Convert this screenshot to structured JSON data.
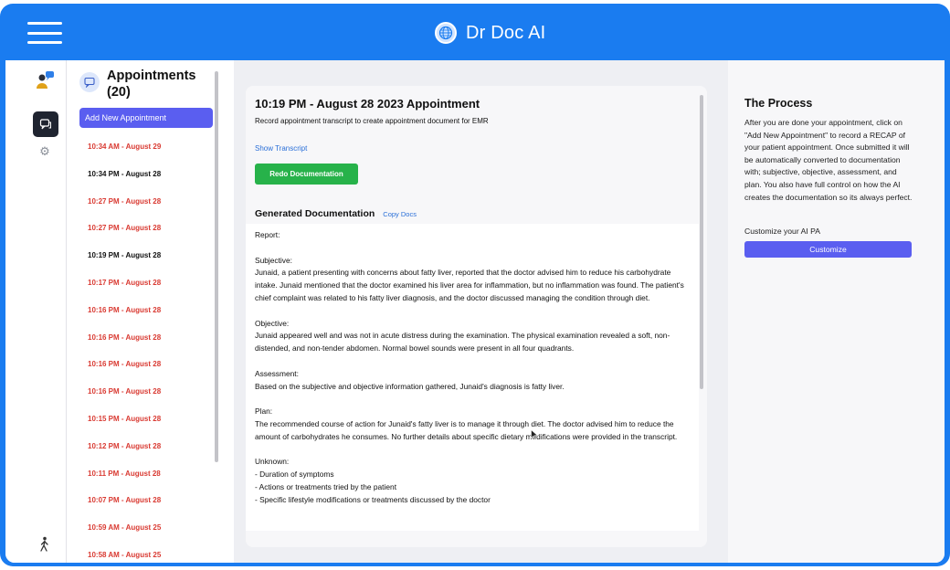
{
  "header": {
    "app_title": "Dr Doc AI",
    "menu_icon": "hamburger-menu-icon",
    "logo_icon": "globe-icon"
  },
  "rail": {
    "icons": [
      "people-chat-icon",
      "chat-icon",
      "gear-icon",
      "walking-person-icon"
    ]
  },
  "appointments": {
    "title": "Appointments (20)",
    "add_label": "Add New Appointment",
    "items": [
      {
        "label": "10:34 AM - August 29",
        "selected": false
      },
      {
        "label": "10:34 PM - August 28",
        "selected": true
      },
      {
        "label": "10:27 PM - August 28",
        "selected": false
      },
      {
        "label": "10:27 PM - August 28",
        "selected": false
      },
      {
        "label": "10:19 PM - August 28",
        "selected": true
      },
      {
        "label": "10:17 PM - August 28",
        "selected": false
      },
      {
        "label": "10:16 PM - August 28",
        "selected": false
      },
      {
        "label": "10:16 PM - August 28",
        "selected": false
      },
      {
        "label": "10:16 PM - August 28",
        "selected": false
      },
      {
        "label": "10:16 PM - August 28",
        "selected": false
      },
      {
        "label": "10:15 PM - August 28",
        "selected": false
      },
      {
        "label": "10:12 PM - August 28",
        "selected": false
      },
      {
        "label": "10:11 PM - August 28",
        "selected": false
      },
      {
        "label": "10:07 PM - August 28",
        "selected": false
      },
      {
        "label": "10:59 AM - August 25",
        "selected": false
      },
      {
        "label": "10:58 AM - August 25",
        "selected": false
      }
    ]
  },
  "main": {
    "appointment_title": "10:19 PM - August 28 2023 Appointment",
    "subtitle": "Record appointment transcript to create appointment document for EMR",
    "show_transcript": "Show Transcript",
    "redo_label": "Redo Documentation",
    "generated_title": "Generated Documentation",
    "copy_label": "Copy Docs",
    "document": [
      {
        "text": "Report:"
      },
      {
        "text": "Subjective:\nJunaid, a patient presenting with concerns about fatty liver, reported that the doctor advised him to reduce his carbohydrate intake. Junaid mentioned that the doctor examined his liver area for inflammation, but no inflammation was found. The patient's chief complaint was related to his fatty liver diagnosis, and the doctor discussed managing the condition through diet."
      },
      {
        "text": "Objective:\nJunaid appeared well and was not in acute distress during the examination. The physical examination revealed a soft, non-distended, and non-tender abdomen. Normal bowel sounds were present in all four quadrants."
      },
      {
        "text": "Assessment:\nBased on the subjective and objective information gathered, Junaid's diagnosis is fatty liver."
      },
      {
        "text": "Plan:\nThe recommended course of action for Junaid's fatty liver is to manage it through diet. The doctor advised him to reduce the amount of carbohydrates he consumes. No further details about specific dietary modifications were provided in the transcript."
      },
      {
        "text": "Unknown:\n- Duration of symptoms\n- Actions or treatments tried by the patient\n- Specific lifestyle modifications or treatments discussed by the doctor"
      }
    ]
  },
  "process": {
    "title": "The Process",
    "text": "After you are done your appointment, click on \"Add New Appointment\" to record a RECAP of your patient appointment. Once submitted it will be automatically converted to documentation with; subjective, objective, assessment, and plan. You also have full control on how the AI creates the documentation so its always perfect.",
    "customize_label": "Customize your AI PA",
    "customize_button": "Customize"
  },
  "colors": {
    "brand_blue": "#1a7cf0",
    "accent_purple": "#5a5ef0",
    "success_green": "#27b24a",
    "appointment_red": "#d93a32"
  }
}
